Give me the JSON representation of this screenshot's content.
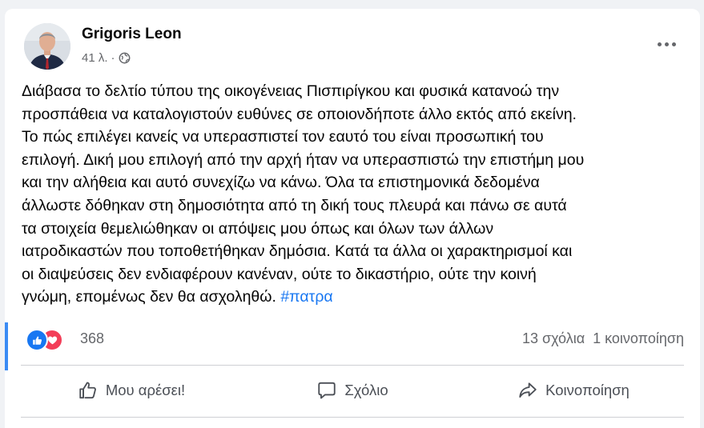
{
  "post": {
    "author": "Grigoris Leon",
    "time": "41 λ.",
    "separator": "·",
    "body_lines": [
      "Διάβασα το δελτίο τύπου της οικογένειας Πισπιρίγκου και φυσικά κατανοώ την",
      "προσπάθεια να καταλογιστούν ευθύνες σε οποιονδήποτε άλλο εκτός από εκείνη.",
      "Το πώς επιλέγει κανείς να υπερασπιστεί τον εαυτό του είναι προσωπική του",
      "επιλογή. Δική μου επιλογή από την αρχή ήταν να υπερασπιστώ την επιστήμη μου",
      "και την αλήθεια και αυτό συνεχίζω να κάνω. Όλα τα επιστημονικά δεδομένα",
      "άλλωστε δόθηκαν στη δημοσιότητα από τη δική τους πλευρά και πάνω σε αυτά",
      "τα στοιχεία θεμελιώθηκαν οι απόψεις μου όπως και όλων των άλλων",
      "ιατροδικαστών που τοποθετήθηκαν δημόσια. Κατά τα άλλα οι χαρακτηρισμοί και",
      "οι διαψεύσεις δεν ενδιαφέρουν κανέναν, ούτε το δικαστήριο, ούτε την κοινή"
    ],
    "last_line": "γνώμη, επομένως δεν θα ασχοληθώ.",
    "hashtag": "#πατρα"
  },
  "stats": {
    "reactions_count": "368",
    "comments": "13 σχόλια",
    "shares": "1 κοινοποίηση"
  },
  "actions": {
    "like": "Μου αρέσει!",
    "comment": "Σχόλιο",
    "share": "Κοινοποίηση"
  },
  "colors": {
    "accent": "#1877f2",
    "love": "#f33e58",
    "secondary_text": "#65676b"
  },
  "icons": {
    "privacy": "globe-icon",
    "menu": "more-options-icon",
    "like": "thumbs-up-icon",
    "comment": "comment-bubble-icon",
    "share": "share-arrow-icon"
  }
}
